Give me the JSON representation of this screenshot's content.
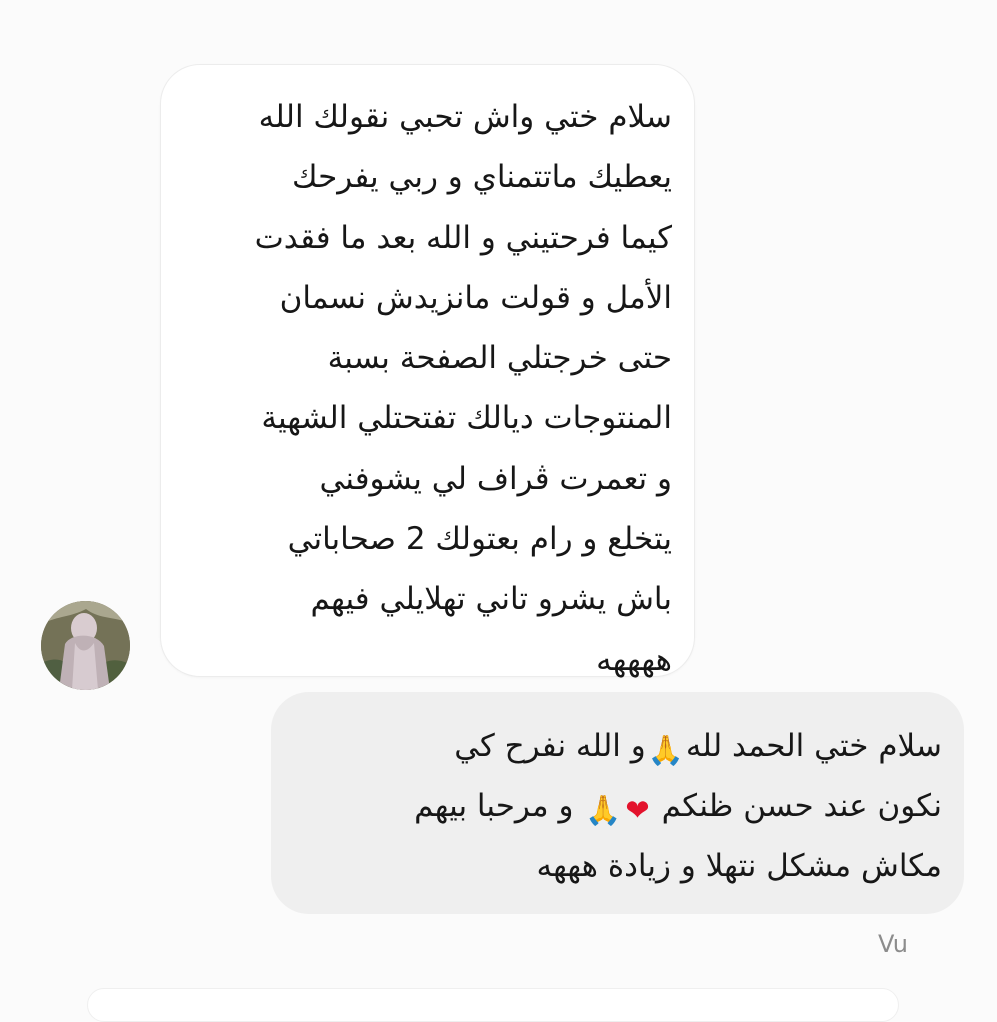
{
  "conversation": {
    "incoming_message": {
      "text": "سلام ختي واش تحبي نقولك الله\nيعطيك ماتتمناي و ربي يفرحك\nكيما فرحتيني و الله بعد ما فقدت\nالأمل و قولت مانزيدش نسمان\nحتى خرجتلي الصفحة بسبة\nالمنتوجات ديالك تفتحتلي الشهية\nو تعمرت ڨراف لي يشوفني\nيتخلع و رام بعتولك 2 صحاباتي\nباش يشرو تاني تهلايلي فيهم\nههههه"
    },
    "outgoing_message": {
      "line1_part1": "سلام ختي الحمد لله",
      "line1_part2": "و الله نفرح كي",
      "line2_part1": "نكون عند حسن ظنكم",
      "line2_part2": "و مرحبا بيهم",
      "line3": "مكاش مشكل نتهلا و زيادة هههه",
      "emoji_pray": "🙏",
      "emoji_heart": "❤"
    },
    "seen_status": "Vu"
  },
  "colors": {
    "background": "#fbfbfb",
    "incoming_bubble": "#ffffff",
    "outgoing_bubble": "#efefef",
    "text": "#171717",
    "seen_status": "#8c8c8c"
  },
  "icons": {
    "avatar": "profile-avatar",
    "pray": "folded-hands-emoji",
    "heart": "red-heart-emoji"
  }
}
